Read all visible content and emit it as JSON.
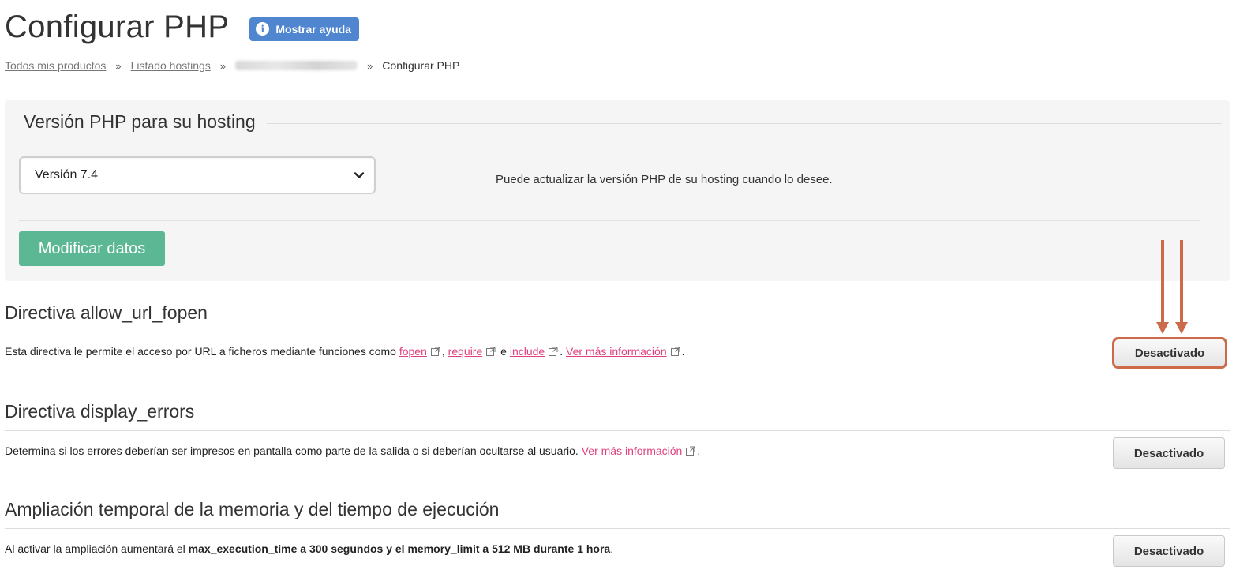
{
  "page": {
    "title": "Configurar PHP",
    "help_button": "Mostrar ayuda"
  },
  "breadcrumb": {
    "items": [
      "Todos mis productos",
      "Listado hostings"
    ],
    "current": "Configurar PHP",
    "separator": "»"
  },
  "php_version": {
    "legend": "Versión PHP para su hosting",
    "selected": "Versión 7.4",
    "note": "Puede actualizar la versión PHP de su hosting cuando lo desee.",
    "submit": "Modificar datos"
  },
  "directives": [
    {
      "title": "Directiva allow_url_fopen",
      "desc_prefix": "Esta directiva le permite el acceso por URL a ficheros mediante funciones como",
      "links": [
        "fopen",
        "require",
        "include"
      ],
      "conj": "e",
      "more": "Ver más información",
      "status": "Desactivado"
    },
    {
      "title": "Directiva display_errors",
      "desc_prefix": "Determina si los errores deberían ser impresos en pantalla como parte de la salida o si deberían ocultarse al usuario.",
      "more": "Ver más información",
      "status": "Desactivado"
    },
    {
      "title": "Ampliación temporal de la memoria y del tiempo de ejecución",
      "desc_prefix": "Al activar la ampliación aumentará el",
      "desc_bold": "max_execution_time a 300 segundos y el memory_limit a 512 MB durante 1 hora",
      "status": "Desactivado"
    }
  ],
  "colors": {
    "help_button": "#4f86cf",
    "modify_button": "#5bb794",
    "link": "#e0417e",
    "annotation": "#cd6a49"
  },
  "icons": {
    "help": "info-icon",
    "select": "chevron-down-icon",
    "external": "external-link-icon"
  }
}
